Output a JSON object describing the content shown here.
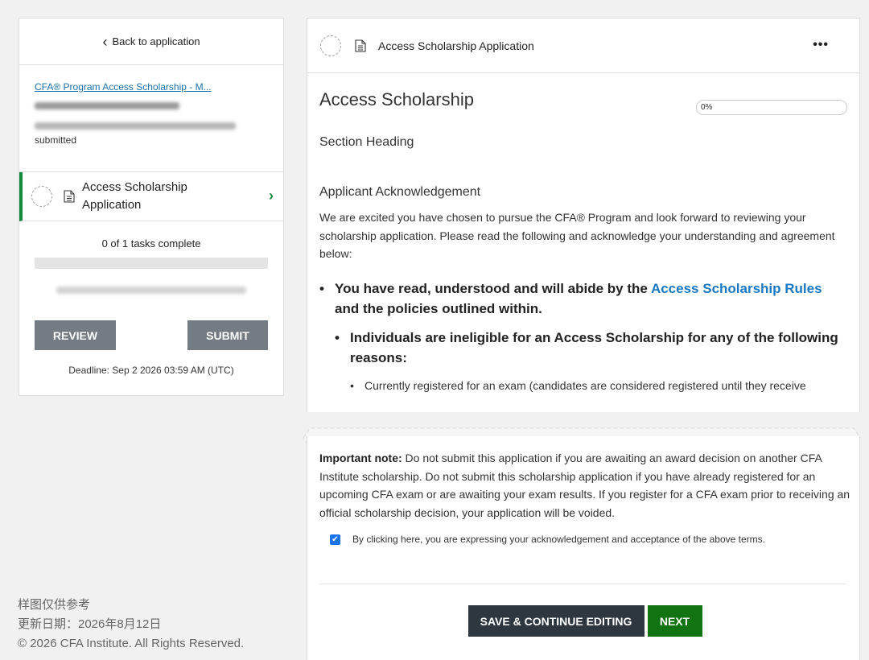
{
  "sidebar": {
    "back_label": "Back to application",
    "app_link": "CFA® Program Access Scholarship - M...",
    "status_text": "submitted",
    "task_item_label": "Access Scholarship Application",
    "tasks_complete": "0 of 1 tasks complete",
    "tasks_progress": 0,
    "review_label": "REVIEW",
    "submit_label": "SUBMIT",
    "deadline": "Deadline: Sep 2 2026 03:59 AM (UTC)"
  },
  "footer": {
    "line1": "样图仅供参考",
    "line2": "更新日期：2026年8月12日",
    "line3": "© 2026 CFA Institute. All Rights Reserved."
  },
  "main": {
    "header_title": "Access Scholarship Application",
    "more_icon": "•••",
    "title": "Access Scholarship",
    "progress_pct": "0%",
    "section_heading": "Section Heading",
    "ack_heading": "Applicant Acknowledgement",
    "intro_paragraph": "We are excited you have chosen to pursue the CFA® Program and look forward to reviewing your scholarship application. Please read the following and acknowledge your understanding and agreement below:",
    "bullet1_before": "You have read, understood and will abide by the ",
    "bullet1_link": "Access Scholarship Rules",
    "bullet1_after": " and the policies outlined within.",
    "bullet2": "Individuals are ineligible for an Access Scholarship for any of the following reasons:",
    "bullet3": "Currently registered for an exam (candidates are considered registered until they receive",
    "note_label": "Important note:",
    "note_text": " Do not submit this application if you are awaiting an award decision on another CFA Institute scholarship. Do not submit this scholarship application if you have already registered for an upcoming CFA exam or are awaiting your exam results. If you register for a CFA exam prior to receiving an official scholarship decision, your application will be voided.",
    "checkbox_label": "By clicking here, you are expressing your acknowledgement and acceptance of the above terms.",
    "checkbox_checked": true,
    "save_label": "SAVE & CONTINUE EDITING",
    "next_label": "NEXT"
  },
  "colors": {
    "accent_green": "#148a3c",
    "next_green": "#117312",
    "link_blue": "#1a78c2",
    "button_gray": "#747b82",
    "button_dark": "#2e3740"
  }
}
